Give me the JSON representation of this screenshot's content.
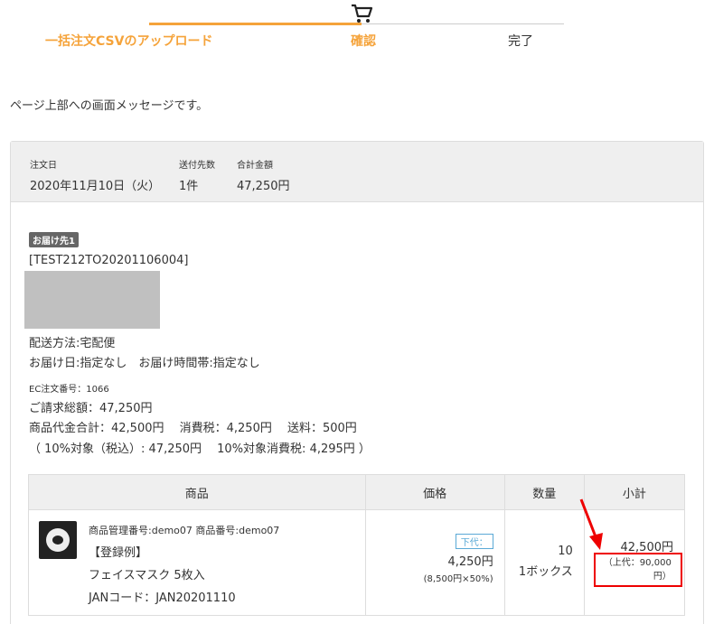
{
  "stepper": {
    "steps": [
      "一括注文CSVのアップロード",
      "確認",
      "完了"
    ],
    "icon": "cart-icon",
    "colors": {
      "active": "#f5a33a",
      "inactive": "#333333"
    }
  },
  "page_message": "ページ上部への画面メッセージです。",
  "summary": {
    "order_date_label": "注文日",
    "order_date": "2020年11月10日（火）",
    "destinations_label": "送付先数",
    "destinations": "1件",
    "total_label": "合計金額",
    "total": "47,250円"
  },
  "shipping": {
    "badge": "お届け先1",
    "code": "[TEST212TO20201106004]",
    "method": "配送方法:宅配便",
    "delivery": "お届け日:指定なし　お届け時間帯:指定なし",
    "ec_number": "EC注文番号：1066",
    "billing_total": "ご請求総額：47,250円",
    "breakdown": "商品代金合計：42,500円　 消費税：4,250円　 送料：500円",
    "tax_detail": "（ 10%対象（税込）: 47,250円　  10%対象消費税: 4,295円 ）"
  },
  "table": {
    "headers": [
      "商品",
      "価格",
      "数量",
      "小計"
    ],
    "row": {
      "codes": "商品管理番号:demo07 商品番号:demo07",
      "name_tag": "【登録例】",
      "name": "フェイスマスク 5枚入",
      "jan": "JANコード：JAN20201110",
      "price_tag": "下代：",
      "price": "4,250円",
      "price_note": "(8,500円×50%)",
      "qty": "10",
      "unit": "1ボックス",
      "subtotal": "42,500円",
      "retail_line1": "（上代：90,000",
      "retail_line2": "円）"
    }
  }
}
